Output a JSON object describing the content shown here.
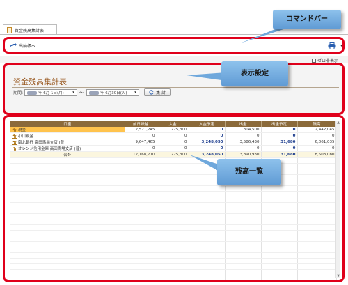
{
  "tab": {
    "label": "資金残高集計表"
  },
  "command_bar": {
    "back_label": "出納帳へ"
  },
  "zero_hide": {
    "label": "ゼロ非表示",
    "checked": false
  },
  "settings": {
    "title": "資金残高集計表",
    "period_label": "期間:",
    "date_from": "年 6月 1日(月)",
    "date_to": "年 6月30日(火)",
    "range_sep": "～",
    "aggregate_button": "集 計"
  },
  "table": {
    "headers": [
      "口座",
      "前日繰越",
      "入金",
      "入金予定",
      "出金",
      "出金予定",
      "残高"
    ],
    "rows": [
      {
        "account": "現金",
        "prev": "2,521,245",
        "in": "225,300",
        "in_plan": "0",
        "out": "304,500",
        "out_plan": "0",
        "balance": "2,442,045"
      },
      {
        "account": "小口現金",
        "prev": "0",
        "in": "0",
        "in_plan": "0",
        "out": "0",
        "out_plan": "0",
        "balance": "0"
      },
      {
        "account": "南北銀行 高田馬場支店 (普)",
        "prev": "9,647,465",
        "in": "0",
        "in_plan": "3,248,050",
        "out": "3,586,430",
        "out_plan": "31,680",
        "balance": "6,061,035"
      },
      {
        "account": "オレンジ信用金庫 高田馬場支店 (普)",
        "prev": "0",
        "in": "0",
        "in_plan": "0",
        "out": "0",
        "out_plan": "0",
        "balance": "0"
      }
    ],
    "total": {
      "account": "合計",
      "prev": "12,168,710",
      "in": "225,300",
      "in_plan": "3,248,050",
      "out": "3,890,930",
      "out_plan": "31,680",
      "balance": "8,503,080"
    }
  },
  "callouts": {
    "command_bar": "コマンドバー",
    "display_settings": "表示設定",
    "balance_list": "残高一覧"
  },
  "colors": {
    "highlight_border": "#e0001b",
    "header_brown": "#8b6a3a",
    "selected_row": "#ffc34d",
    "callout_blue": "#6fa8dc",
    "plan_text": "#1f3f8f"
  },
  "icons": {
    "back": "arrow-back-icon",
    "print": "printer-icon",
    "refresh": "refresh-icon",
    "account": "bank-icon",
    "tab_doc": "document-icon"
  }
}
